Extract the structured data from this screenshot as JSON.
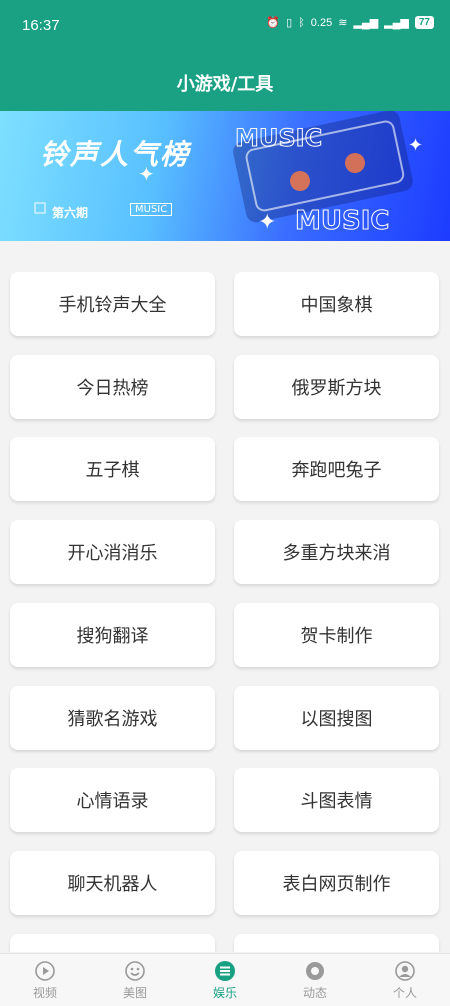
{
  "status": {
    "time": "16:37",
    "net": "0.25",
    "battery": "77"
  },
  "header": {
    "title": "小游戏/工具"
  },
  "banner": {
    "title": "铃声人气榜",
    "issue": "第六期",
    "tag": "MUSIC"
  },
  "items": [
    {
      "label": "手机铃声大全"
    },
    {
      "label": "中国象棋"
    },
    {
      "label": "今日热榜"
    },
    {
      "label": "俄罗斯方块"
    },
    {
      "label": "五子棋"
    },
    {
      "label": "奔跑吧兔子"
    },
    {
      "label": "开心消消乐"
    },
    {
      "label": "多重方块来消"
    },
    {
      "label": "搜狗翻译"
    },
    {
      "label": "贺卡制作"
    },
    {
      "label": "猜歌名游戏"
    },
    {
      "label": "以图搜图"
    },
    {
      "label": "心情语录"
    },
    {
      "label": "斗图表情"
    },
    {
      "label": "聊天机器人"
    },
    {
      "label": "表白网页制作"
    }
  ],
  "nav": [
    {
      "label": "视频",
      "icon": "play-icon"
    },
    {
      "label": "美图",
      "icon": "face-icon"
    },
    {
      "label": "娱乐",
      "icon": "list-icon"
    },
    {
      "label": "动态",
      "icon": "aperture-icon"
    },
    {
      "label": "个人",
      "icon": "user-icon"
    }
  ],
  "colors": {
    "brand": "#1aa184"
  }
}
